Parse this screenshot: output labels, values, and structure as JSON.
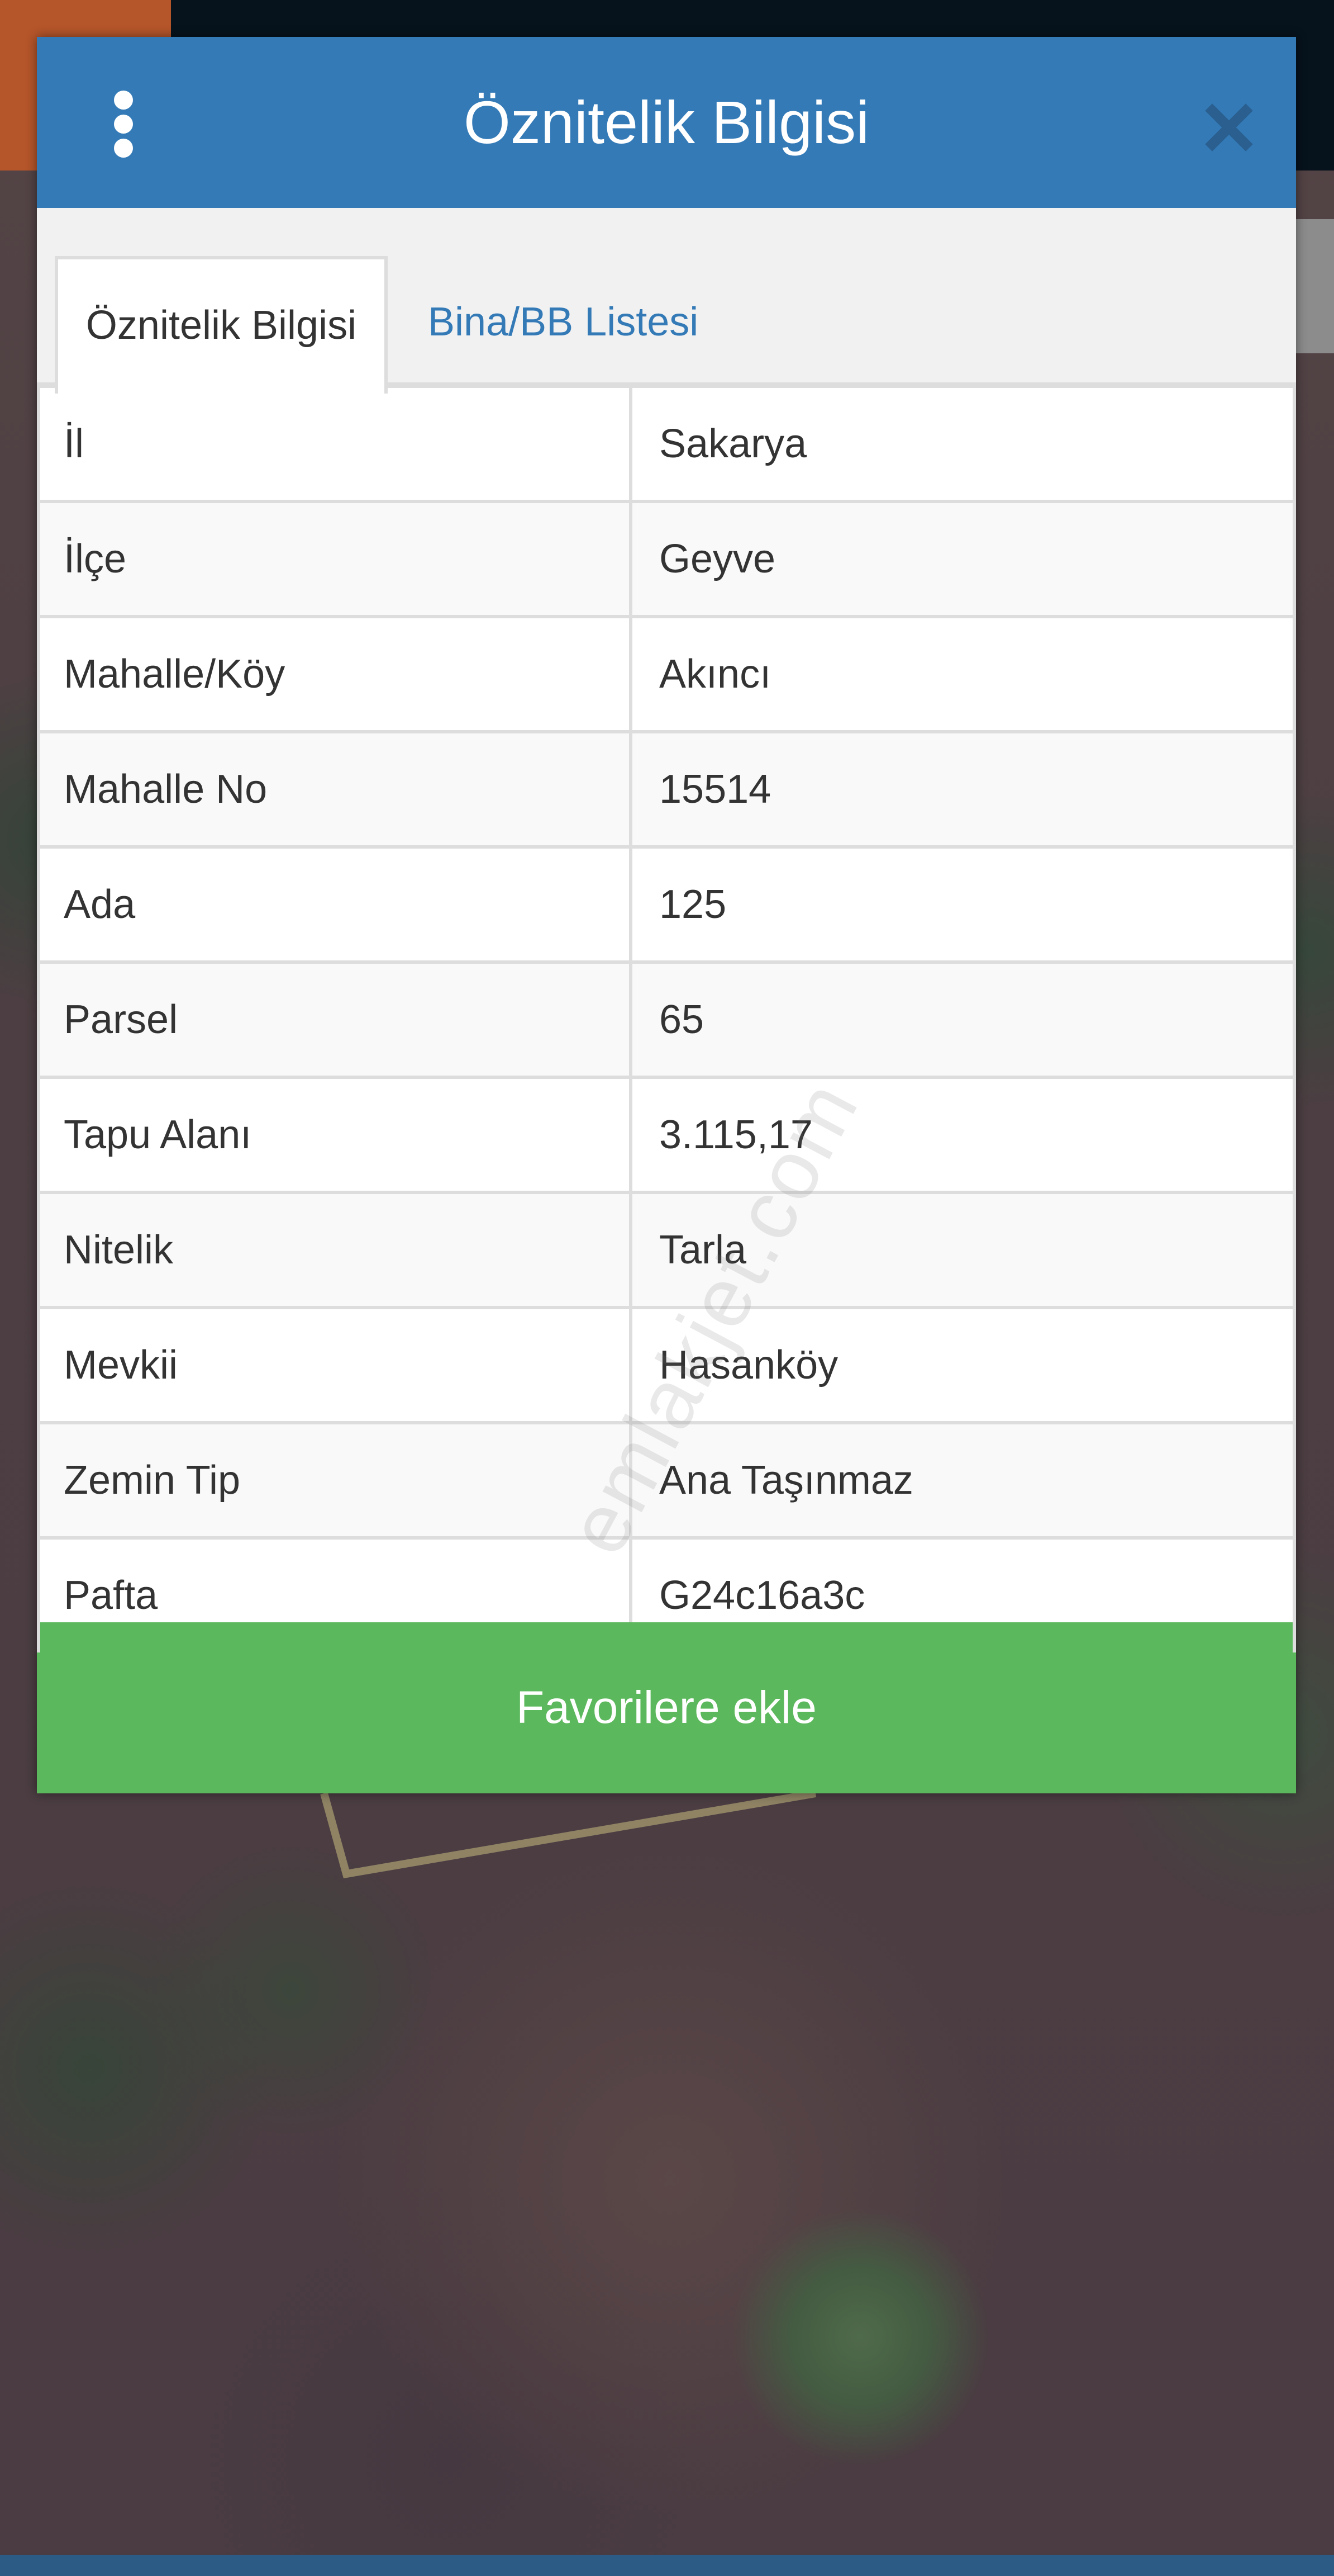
{
  "header": {
    "title": "Öznitelik Bilgisi",
    "menu_icon": "vertical-dots-icon",
    "close_icon": "close-icon"
  },
  "tabs": [
    {
      "label": "Öznitelik Bilgisi",
      "active": true
    },
    {
      "label": "Bina/BB Listesi",
      "active": false
    }
  ],
  "attributes": [
    {
      "label": "İl",
      "value": "Sakarya"
    },
    {
      "label": "İlçe",
      "value": "Geyve"
    },
    {
      "label": "Mahalle/Köy",
      "value": "Akıncı"
    },
    {
      "label": "Mahalle No",
      "value": "15514"
    },
    {
      "label": "Ada",
      "value": "125"
    },
    {
      "label": "Parsel",
      "value": "65"
    },
    {
      "label": "Tapu Alanı",
      "value": "3.115,17"
    },
    {
      "label": "Nitelik",
      "value": "Tarla"
    },
    {
      "label": "Mevkii",
      "value": "Hasanköy"
    },
    {
      "label": "Zemin Tip",
      "value": "Ana Taşınmaz"
    },
    {
      "label": "Pafta",
      "value": "G24c16a3c"
    }
  ],
  "footer": {
    "favorite_label": "Favorilere ekle"
  },
  "watermark": "emlakjet.com",
  "colors": {
    "header_blue": "#337ab7",
    "tab_link_blue": "#337ab7",
    "favorite_green": "#5cb85c",
    "close_icon": "#2a5f8f"
  }
}
